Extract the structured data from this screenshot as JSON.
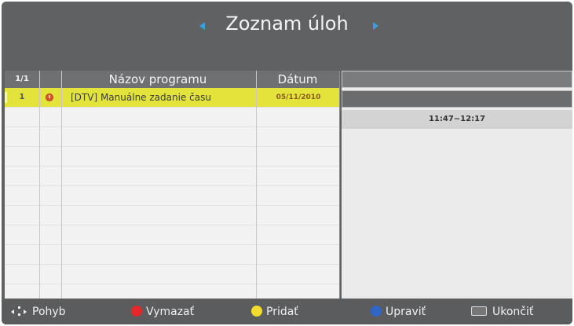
{
  "header": {
    "title": "Zoznam úloh"
  },
  "table": {
    "page": "1/1",
    "columns": {
      "name": "Názov programu",
      "date": "Dátum"
    },
    "rows": [
      {
        "num": "1",
        "icon": "timer-icon",
        "name": "[DTV] Manuálne zadanie času",
        "date": "05/11/2010",
        "selected": true
      }
    ],
    "empty_rows": 10
  },
  "details": {
    "time": "11:47~12:17"
  },
  "footer": {
    "move": {
      "label": "Pohyb",
      "icon": "navigation-arrows-icon"
    },
    "delete": {
      "label": "Vymazať",
      "color": "#e8262a"
    },
    "add": {
      "label": "Pridať",
      "color": "#f1dd2a"
    },
    "edit": {
      "label": "Upraviť",
      "color": "#2f66c8"
    },
    "exit": {
      "label": "Ukončiť",
      "icon": "exit-key-icon"
    }
  },
  "colors": {
    "selected_row": "#e3e43b",
    "background": "#5f6163",
    "accent_arrows": "#3a9fe0"
  }
}
